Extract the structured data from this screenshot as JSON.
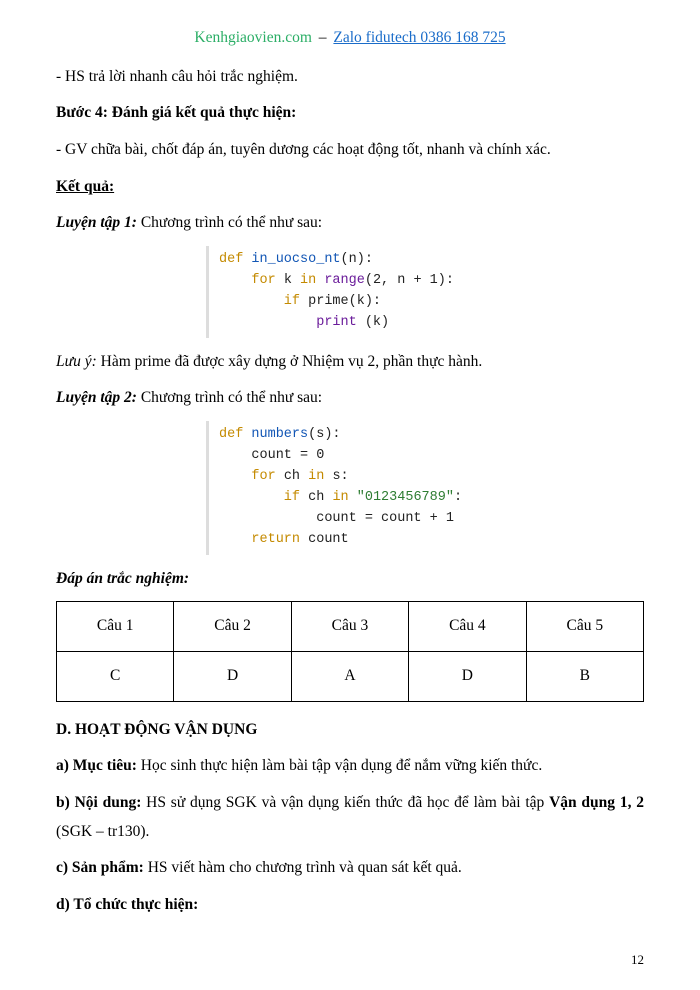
{
  "header": {
    "site": "Kenhgiaovien.com",
    "dash": "–",
    "zalo": "Zalo fidutech 0386 168 725"
  },
  "lines": {
    "l1": "- HS trả lời nhanh câu hỏi trắc nghiệm.",
    "step4_label": "Bước 4: Đánh giá kết quả thực hiện:",
    "l2": "- GV chữa bài, chốt đáp án, tuyên dương các hoạt động tốt, nhanh và chính xác.",
    "result_label": "Kết quả:",
    "lt1_label": "Luyện tập 1:",
    "lt1_text": " Chương trình có thể như sau:",
    "luuy_label": "Lưu ý:",
    "luuy_text": " Hàm prime đã được xây dựng ở Nhiệm vụ 2, phần thực hành.",
    "lt2_label": "Luyện tập 2:",
    "lt2_text": " Chương trình có thể như sau:",
    "dapan_label": "Đáp án trắc nghiệm:",
    "sectionD": "D. HOẠT ĐỘNG VẬN DỤNG",
    "a_label": "a) Mục tiêu:",
    "a_text": " Học sinh thực hiện làm bài tập vận dụng để nắm vững kiến thức.",
    "b_label": "b) Nội dung:",
    "b_text1": " HS sử dụng SGK và vận dụng kiến thức đã học để làm bài tập ",
    "b_bold2": "Vận dụng 1, 2",
    "b_text2": " (SGK – tr130).",
    "c_label": "c) Sản phẩm:",
    "c_text": " HS viết hàm cho chương trình và quan sát kết quả.",
    "d_label": "d) Tổ chức thực hiện:"
  },
  "code1": {
    "c1": "def ",
    "c1n": "in_uocso_nt",
    "c1p": "(n):",
    "c2a": "    for ",
    "c2b": "k ",
    "c2c": "in ",
    "c2d": "range",
    "c2e": "(2, n + 1):",
    "c3a": "        if ",
    "c3b": "prime(k):",
    "c4a": "            print ",
    "c4b": "(k)"
  },
  "code2": {
    "d1": "def ",
    "d1n": "numbers",
    "d1p": "(s):",
    "d2": "    count = 0",
    "d3a": "    for ",
    "d3b": "ch ",
    "d3c": "in ",
    "d3d": "s:",
    "d4a": "        if ",
    "d4b": "ch ",
    "d4c": "in ",
    "d4s": "\"0123456789\"",
    "d4e": ":",
    "d5": "            count = count + 1",
    "d6a": "    return ",
    "d6b": "count"
  },
  "table": {
    "headers": [
      "Câu 1",
      "Câu 2",
      "Câu 3",
      "Câu 4",
      "Câu 5"
    ],
    "answers": [
      "C",
      "D",
      "A",
      "D",
      "B"
    ]
  },
  "page_number": "12"
}
